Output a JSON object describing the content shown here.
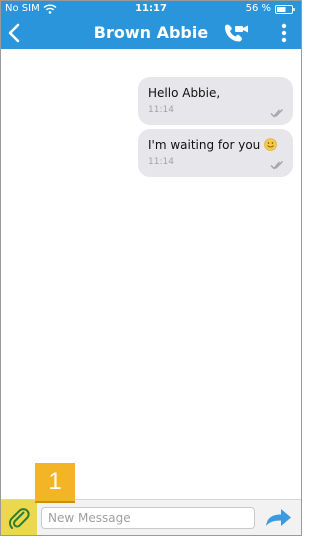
{
  "status_bar": {
    "carrier": "No SIM",
    "time": "11:17",
    "battery": "56 %",
    "icons": [
      "wifi-icon",
      "battery-icon"
    ]
  },
  "nav": {
    "title": "Brown Abbie",
    "icons": [
      "back-chevron-icon",
      "video-call-icon",
      "more-vertical-icon"
    ]
  },
  "messages": [
    {
      "text": "Hello Abbie,",
      "time": "11:14",
      "direction": "outgoing",
      "status_icon": "double-check-icon"
    },
    {
      "text": "I'm waiting for you",
      "emoji": "slightly-smiling-face",
      "time": "11:14",
      "direction": "outgoing",
      "status_icon": "double-check-icon"
    }
  ],
  "composer": {
    "placeholder": "New Message",
    "value": "",
    "icons": [
      "paperclip-icon",
      "send-arrow-icon"
    ]
  },
  "callout": {
    "label": "1"
  },
  "colors": {
    "header": "#2b95dc",
    "bubble": "#e6e6eb",
    "attach_highlight": "#ecd84c",
    "callout": "#f3b425",
    "send_arrow": "#3a9be0"
  }
}
